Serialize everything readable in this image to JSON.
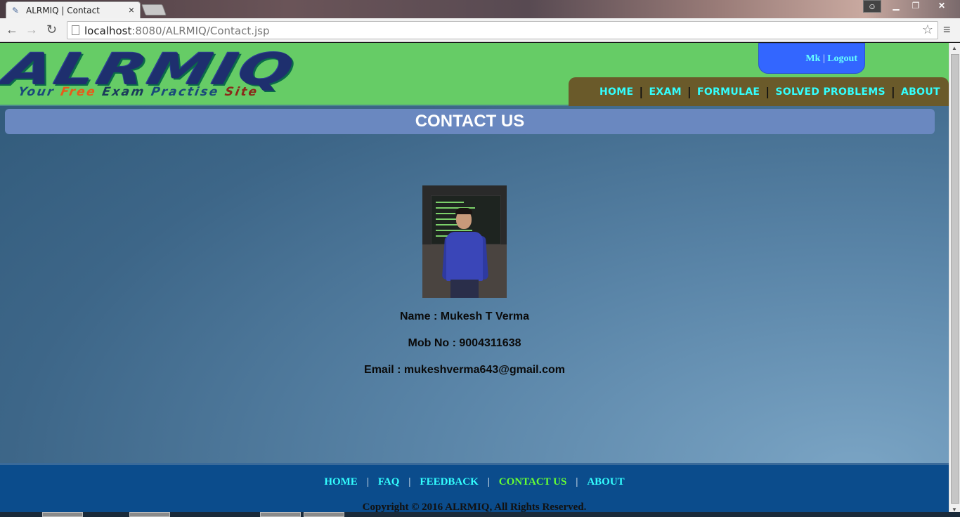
{
  "browser": {
    "tab_title": "ALRMIQ | Contact",
    "url_host": "localhost",
    "url_path": ":8080/ALRMIQ/Contact.jsp"
  },
  "header": {
    "logo_main": "ALRMIQ",
    "tagline": [
      "Your",
      "Free",
      "Exam",
      "Practise",
      "Site"
    ],
    "user": "Mk",
    "logout": "Logout",
    "nav": [
      "HOME",
      "EXAM",
      "FORMULAE",
      "SOLVED PROBLEMS",
      "ABOUT"
    ]
  },
  "page": {
    "title": "CONTACT US",
    "name": "Name : Mukesh T Verma",
    "mob": "Mob No : 9004311638",
    "email": "Email : mukeshverma643@gmail.com"
  },
  "footer": {
    "nav": [
      "HOME",
      "FAQ",
      "FEEDBACK",
      "CONTACT US",
      "ABOUT"
    ],
    "copyright": "Copyright © 2016 ALRMIQ, All Rights Reserved."
  },
  "colors": {
    "header_bg": "#66cc66",
    "nav_text": "#33ffff",
    "footer_active": "#66ff33",
    "footer_bg": "#0b4c8c"
  }
}
